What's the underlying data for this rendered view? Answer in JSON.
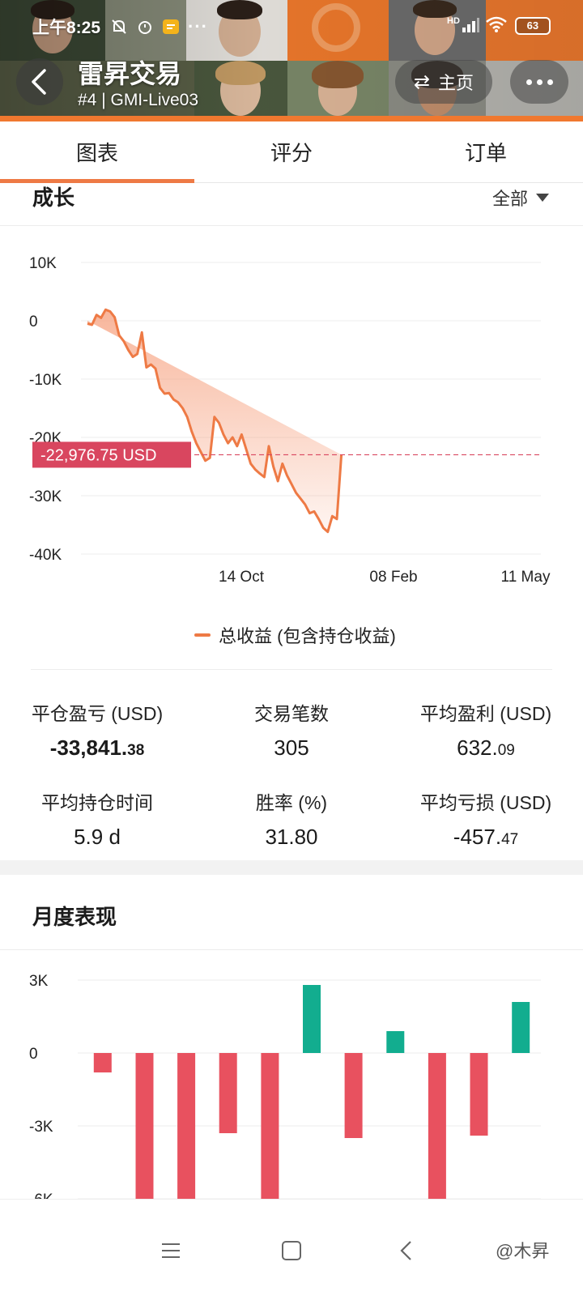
{
  "status_bar": {
    "time": "上午8:25",
    "network": "HD",
    "battery": "63"
  },
  "header": {
    "title": "雷昇交易",
    "subtitle": "#4 | GMI-Live03",
    "home_label": "主页"
  },
  "tabs": [
    {
      "label": "图表",
      "active": true
    },
    {
      "label": "评分",
      "active": false
    },
    {
      "label": "订单",
      "active": false
    }
  ],
  "growth": {
    "title": "成长",
    "filter": "全部"
  },
  "chart_data": {
    "type": "area",
    "x": [
      0,
      1,
      2,
      3,
      4,
      5,
      6,
      7,
      8,
      9,
      10,
      11,
      12,
      13,
      14,
      15,
      16,
      17,
      18,
      19,
      20,
      21,
      22,
      23,
      24,
      25,
      26,
      27,
      28,
      29,
      30,
      31,
      32,
      33,
      34,
      35,
      36,
      37,
      38,
      39,
      40,
      41,
      42,
      43,
      44,
      45,
      46,
      47,
      48,
      49,
      50,
      51,
      52,
      53,
      54,
      55,
      56,
      57,
      58,
      59,
      60,
      61,
      62,
      63,
      64,
      65,
      66,
      67,
      68,
      69,
      70,
      71,
      72,
      73,
      74,
      75,
      76,
      77,
      78,
      79,
      80,
      81,
      82,
      83,
      84,
      85,
      86,
      87,
      88,
      89,
      90,
      91,
      92,
      93,
      94,
      95,
      96,
      97,
      98,
      99,
      100
    ],
    "y": [
      -500,
      -700,
      1000,
      500,
      1900,
      1600,
      600,
      -2500,
      -3500,
      -5000,
      -6200,
      -5700,
      -2000,
      -8000,
      -7500,
      -8200,
      -11500,
      -12500,
      -12400,
      -13500,
      -14000,
      -15000,
      -16500,
      -19000,
      -21000,
      -22500,
      -24000,
      -23500,
      -16500,
      -17500,
      -19500,
      -21000,
      -20000,
      -21500,
      -19500,
      -22000,
      -24500,
      -25500,
      -26200,
      -26800,
      -21500,
      -25000,
      -27500,
      -24500,
      -26500,
      -28000,
      -29500,
      -30500,
      -31500,
      -33000,
      -32700,
      -34000,
      -35500,
      -36200,
      -33500,
      -34000,
      -22977
    ],
    "x_tick_labels": [
      "14 Oct",
      "08 Feb",
      "11 May"
    ],
    "y_tick_labels": [
      "10K",
      "0",
      "-10K",
      "-20K",
      "-30K",
      "-40K"
    ],
    "ylim": [
      -40000,
      10000
    ],
    "current_value_label": "-22,976.75 USD",
    "current_value": -22976.75,
    "series_name": "总收益 (包含持仓收益)",
    "line_color": "#ee7a45",
    "fill_color": "#f7a98a",
    "marker_color": "#d9465f",
    "grid": true
  },
  "stats": [
    {
      "label": "平仓盈亏 (USD)",
      "value": "-33,841.",
      "decimal": "38"
    },
    {
      "label": "交易笔数",
      "value": "305",
      "decimal": ""
    },
    {
      "label": "平均盈利 (USD)",
      "value": "632.",
      "decimal": "09"
    },
    {
      "label": "平均持仓时间",
      "value": "5.9 d",
      "decimal": ""
    },
    {
      "label": "胜率 (%)",
      "value": "31.80",
      "decimal": ""
    },
    {
      "label": "平均亏损 (USD)",
      "value": "-457.",
      "decimal": "47"
    }
  ],
  "monthly": {
    "title": "月度表现",
    "chart_data": {
      "type": "bar",
      "values": [
        -800,
        -6500,
        -6500,
        -3300,
        -6500,
        2800,
        -3500,
        900,
        -6500,
        -3400,
        2100
      ],
      "y_tick_labels": [
        "3K",
        "0",
        "-3K",
        "-6K"
      ],
      "ylim": [
        -6000,
        3000
      ],
      "positive_color": "#12ad8f",
      "negative_color": "#e8515f",
      "grid": true
    }
  },
  "watermark": "@木昇"
}
